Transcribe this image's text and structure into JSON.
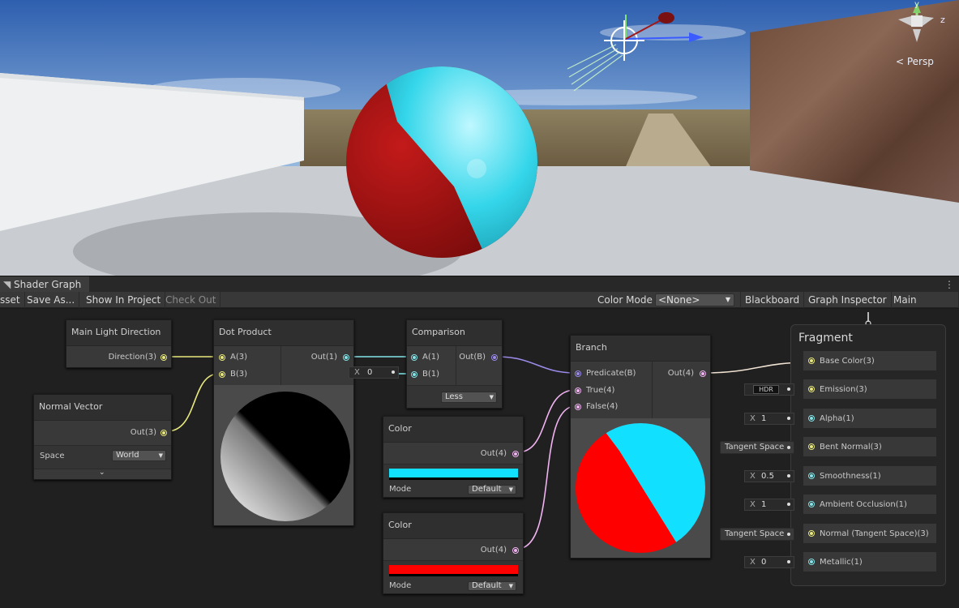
{
  "scene": {
    "persp_label": "< Persp",
    "gizmo": {
      "y_axis": "y",
      "z_axis": "z"
    }
  },
  "window": {
    "tab_title": "Shader Graph",
    "menu_icon": "kebab-menu-icon"
  },
  "toolbar": {
    "save_asset": "sset",
    "save_as": "Save As...",
    "show_in_project": "Show In Project",
    "check_out": "Check Out",
    "color_mode_label": "Color Mode",
    "color_mode_value": "<None>",
    "blackboard": "Blackboard",
    "graph_inspector": "Graph Inspector",
    "main_preview": "Main Preview"
  },
  "nodes": {
    "main_light": {
      "title": "Main Light Direction",
      "out": "Direction(3)"
    },
    "normal_vector": {
      "title": "Normal Vector",
      "out": "Out(3)",
      "space_label": "Space",
      "space_value": "World"
    },
    "dot_product": {
      "title": "Dot Product",
      "in_a": "A(3)",
      "in_b": "B(3)",
      "out": "Out(1)"
    },
    "comparison": {
      "title": "Comparison",
      "in_a": "A(1)",
      "in_b": "B(1)",
      "out": "Out(B)",
      "b_x": "X",
      "b_value": "0",
      "op": "Less"
    },
    "color1": {
      "title": "Color",
      "out": "Out(4)",
      "mode_label": "Mode",
      "mode_value": "Default",
      "swatch": "#12e0ff"
    },
    "color2": {
      "title": "Color",
      "out": "Out(4)",
      "mode_label": "Mode",
      "mode_value": "Default",
      "swatch": "#ff0000"
    },
    "branch": {
      "title": "Branch",
      "predicate": "Predicate(B)",
      "true": "True(4)",
      "false": "False(4)",
      "out": "Out(4)"
    },
    "fragment": {
      "title": "Fragment",
      "slots": [
        {
          "label": "Base Color(3)"
        },
        {
          "label": "Emission(3)",
          "inline": "HDR"
        },
        {
          "label": "Alpha(1)",
          "inline_x": "X",
          "inline": "1"
        },
        {
          "label": "Bent Normal(3)",
          "inline": "Tangent Space"
        },
        {
          "label": "Smoothness(1)",
          "inline_x": "X",
          "inline": "0.5"
        },
        {
          "label": "Ambient Occlusion(1)",
          "inline_x": "X",
          "inline": "1"
        },
        {
          "label": "Normal (Tangent Space)(3)",
          "inline": "Tangent Space"
        },
        {
          "label": "Metallic(1)",
          "inline_x": "X",
          "inline": "0"
        }
      ]
    }
  },
  "colors": {
    "cyan": "#12e0ff",
    "red": "#ff0000",
    "dark_red": "#b51515",
    "canvas": "#202020"
  }
}
